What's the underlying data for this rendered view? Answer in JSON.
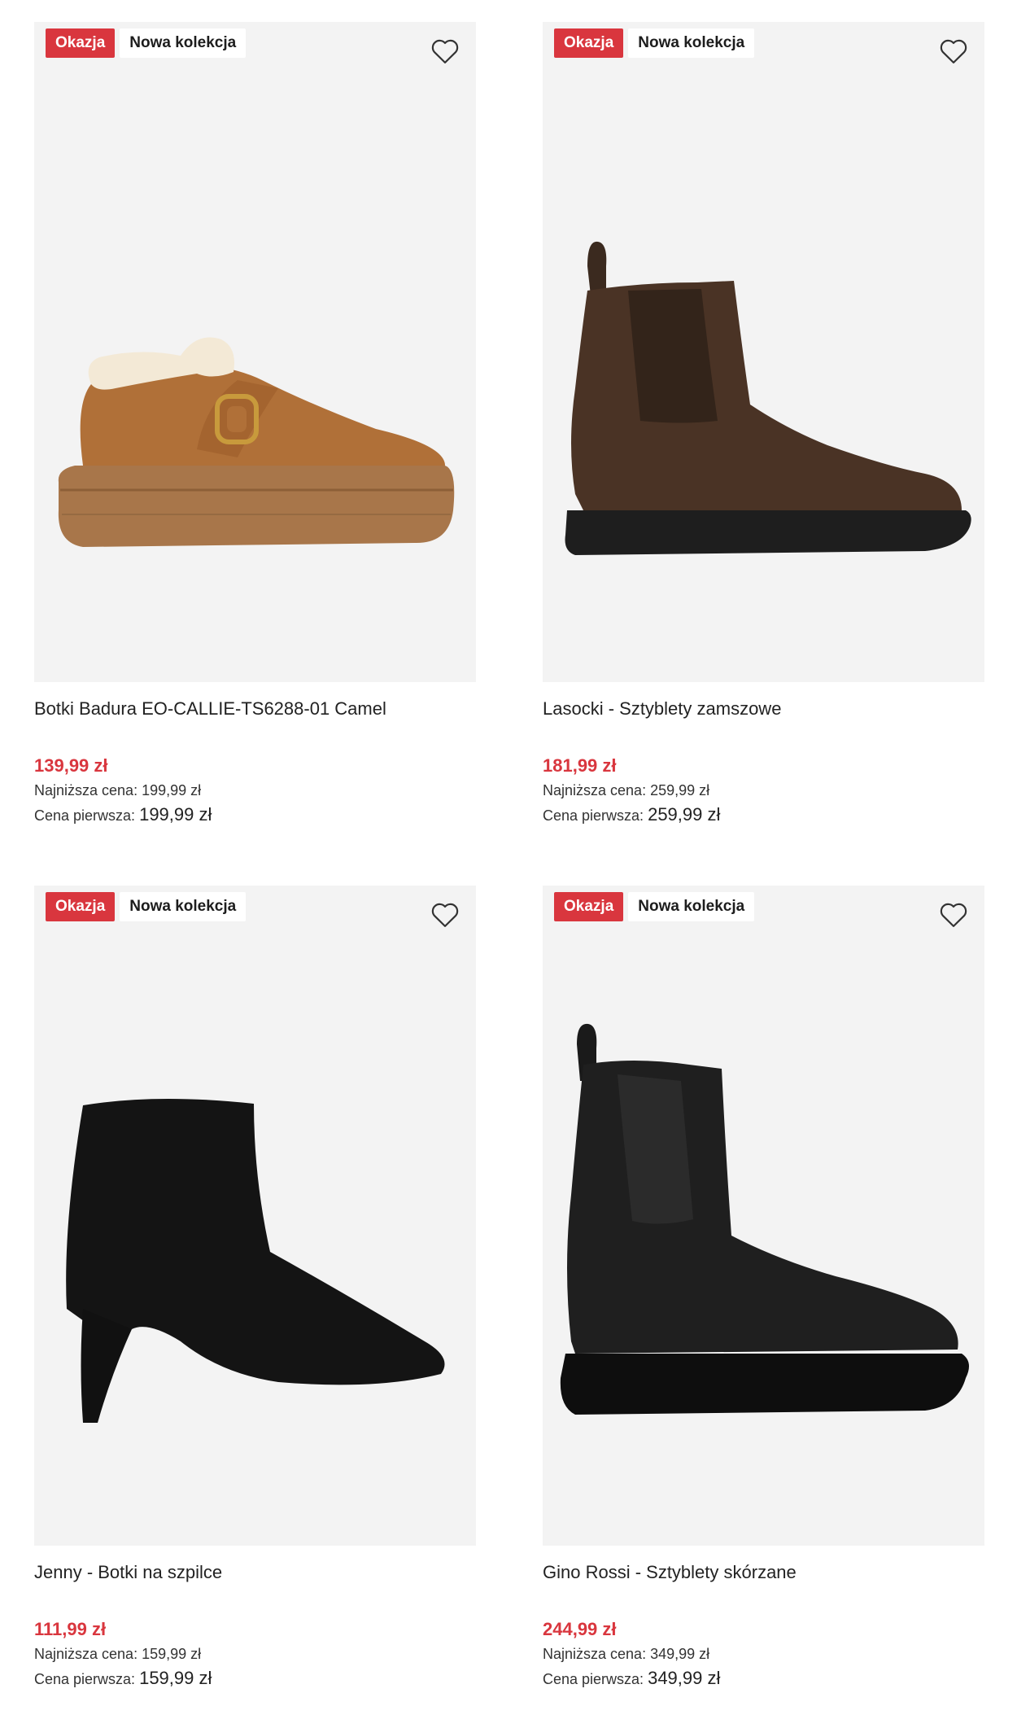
{
  "products": [
    {
      "badge_deal": "Okazja",
      "badge_new": "Nowa kolekcja",
      "title": "Botki Badura EO-CALLIE-TS6288-01 Camel",
      "price": "139,99 zł",
      "lowest_label": "Najniższa cena:",
      "lowest_value": "199,99 zł",
      "first_label": "Cena pierwsza:",
      "first_value": "199,99 zł",
      "image_icon": "camel-fur-clog-image"
    },
    {
      "badge_deal": "Okazja",
      "badge_new": "Nowa kolekcja",
      "title": "Lasocki - Sztyblety zamszowe",
      "price": "181,99 zł",
      "lowest_label": "Najniższa cena:",
      "lowest_value": "259,99 zł",
      "first_label": "Cena pierwsza:",
      "first_value": "259,99 zł",
      "image_icon": "brown-suede-chelsea-boot-image"
    },
    {
      "badge_deal": "Okazja",
      "badge_new": "Nowa kolekcja",
      "title": "Jenny - Botki na szpilce",
      "price": "111,99 zł",
      "lowest_label": "Najniższa cena:",
      "lowest_value": "159,99 zł",
      "first_label": "Cena pierwsza:",
      "first_value": "159,99 zł",
      "image_icon": "black-stiletto-ankle-boot-image"
    },
    {
      "badge_deal": "Okazja",
      "badge_new": "Nowa kolekcja",
      "title": "Gino Rossi - Sztyblety skórzane",
      "price": "244,99 zł",
      "lowest_label": "Najniższa cena:",
      "lowest_value": "349,99 zł",
      "first_label": "Cena pierwsza:",
      "first_value": "349,99 zł",
      "image_icon": "black-leather-chelsea-boot-image"
    }
  ],
  "colors": {
    "deal_red": "#d9363e",
    "card_bg": "#f3f3f3"
  },
  "icons": {
    "favorite": "heart-outline-icon"
  }
}
